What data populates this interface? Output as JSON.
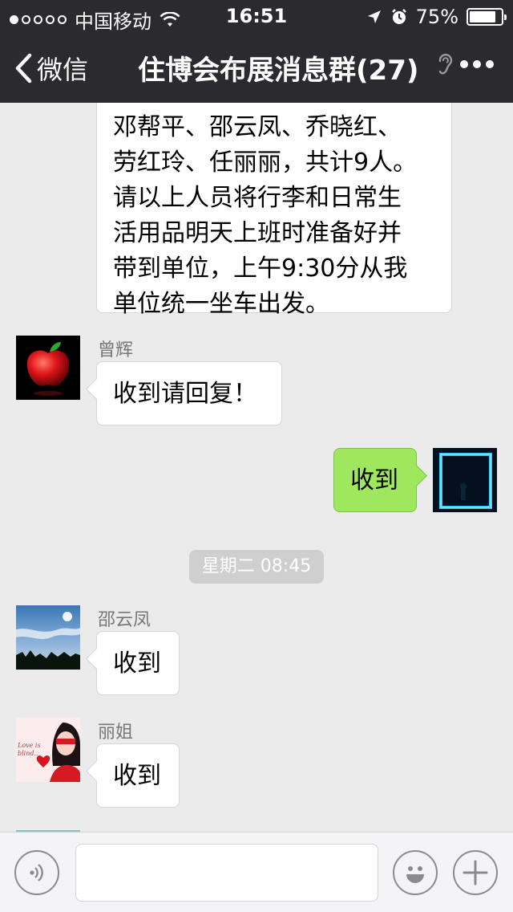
{
  "status_bar": {
    "carrier": "中国移动",
    "time": "16:51",
    "battery": "75%",
    "battery_level": 0.75,
    "signal_bars_filled": 1,
    "signal_bars_total": 5
  },
  "nav": {
    "back_label": "微信",
    "title": "住博会布展消息群(27)"
  },
  "messages": [
    {
      "sender": "",
      "lines": [
        "邓帮平、邵云凤、乔晓红、",
        "劳红玲、任丽丽，共计9人。",
        "请以上人员将行李和日常生",
        "活用品明天上班时准备好并",
        "带到单位，上午9:30分从我",
        "单位统一坐车出发。"
      ]
    },
    {
      "sender": "曾辉",
      "text": "收到请回复！",
      "direction": "in"
    },
    {
      "sender": "",
      "text": "收到",
      "direction": "out"
    },
    {
      "sender": "邵云凤",
      "text": "收到",
      "direction": "in"
    },
    {
      "sender": "丽姐",
      "text": "收到",
      "direction": "in"
    }
  ],
  "timestamp": "星期二 08:45",
  "avatar_3_text": "Love is blind..",
  "input": {
    "placeholder": ""
  },
  "colors": {
    "nav_bg": "#2b2a2f",
    "chat_bg": "#ebebeb",
    "outgoing_bubble": "#9fe75d",
    "incoming_bubble": "#ffffff"
  }
}
